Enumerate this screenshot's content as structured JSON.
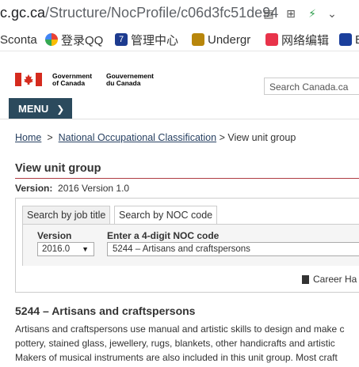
{
  "browser": {
    "url_host": "c.gc.ca",
    "url_path": "/Structure/NocProfile/c06d3fc51de94",
    "bookmarks": [
      {
        "label": "Sconta",
        "icon": "bookmark-icon"
      },
      {
        "label": "登录QQ",
        "icon": "qq-icon"
      },
      {
        "label": "管理中心",
        "icon": "admin-icon"
      },
      {
        "label": "Undergr",
        "icon": "crest-icon"
      },
      {
        "label": "网络编辑",
        "icon": "pig-icon"
      },
      {
        "label": "E",
        "icon": "usn-icon"
      }
    ]
  },
  "header": {
    "gov_en_line1": "Government",
    "gov_en_line2": "of Canada",
    "gov_fr_line1": "Gouvernement",
    "gov_fr_line2": "du Canada",
    "search_placeholder": "Search Canada.ca",
    "menu_label": "MENU"
  },
  "breadcrumb": {
    "home": "Home",
    "sep": ">",
    "noc": "National Occupational Classification",
    "current": "> View unit group"
  },
  "page": {
    "title": "View unit group",
    "version_label": "Version:",
    "version_value": "2016 Version 1.0"
  },
  "search_panel": {
    "tabs": [
      "Search by job title",
      "Search by NOC code"
    ],
    "version_field_label": "Version",
    "version_selected": "2016.0",
    "noc_field_label": "Enter a 4-digit NOC code",
    "noc_value": "5244 – Artisans and craftspersons",
    "career_link": "Career Ha"
  },
  "content": {
    "heading": "5244 – Artisans and craftspersons",
    "para_lines": [
      "Artisans and craftspersons use manual and artistic skills to design and make c",
      "pottery, stained glass, jewellery, rugs, blankets, other handicrafts and artistic",
      "Makers of musical instruments are also included in this unit group. Most craft"
    ]
  },
  "colors": {
    "menu_bg": "#2b4a5d",
    "link": "#284162",
    "title_rule": "#af3c43",
    "flag_red": "#d52b1e"
  }
}
